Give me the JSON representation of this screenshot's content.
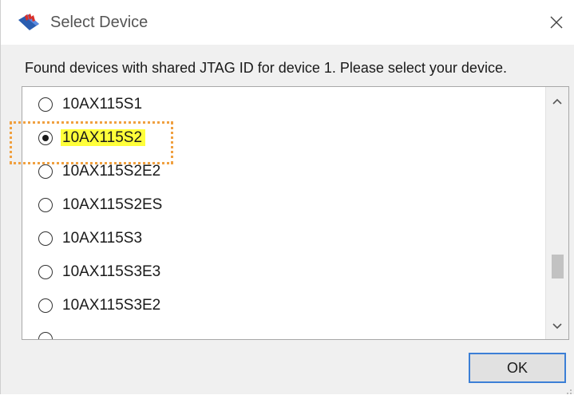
{
  "window": {
    "title": "Select Device",
    "icon": "quartus-app-icon",
    "close_icon": "close-icon"
  },
  "message": "Found devices with shared JTAG ID for device 1. Please select your device.",
  "devices": [
    {
      "label": "10AX115S1",
      "selected": false
    },
    {
      "label": "10AX115S2",
      "selected": true,
      "highlighted": true
    },
    {
      "label": "10AX115S2E2",
      "selected": false
    },
    {
      "label": "10AX115S2ES",
      "selected": false
    },
    {
      "label": "10AX115S3",
      "selected": false
    },
    {
      "label": "10AX115S3E3",
      "selected": false
    },
    {
      "label": "10AX115S3E2",
      "selected": false
    }
  ],
  "scrollbar": {
    "up_icon": "chevron-up-icon",
    "down_icon": "chevron-down-icon"
  },
  "buttons": {
    "ok_label": "OK"
  },
  "colors": {
    "highlight": "#ffff3a",
    "focus_outline": "#f0a040",
    "button_border": "#3c7fd6",
    "icon_blue": "#2a5db0",
    "icon_red": "#d8302a"
  }
}
